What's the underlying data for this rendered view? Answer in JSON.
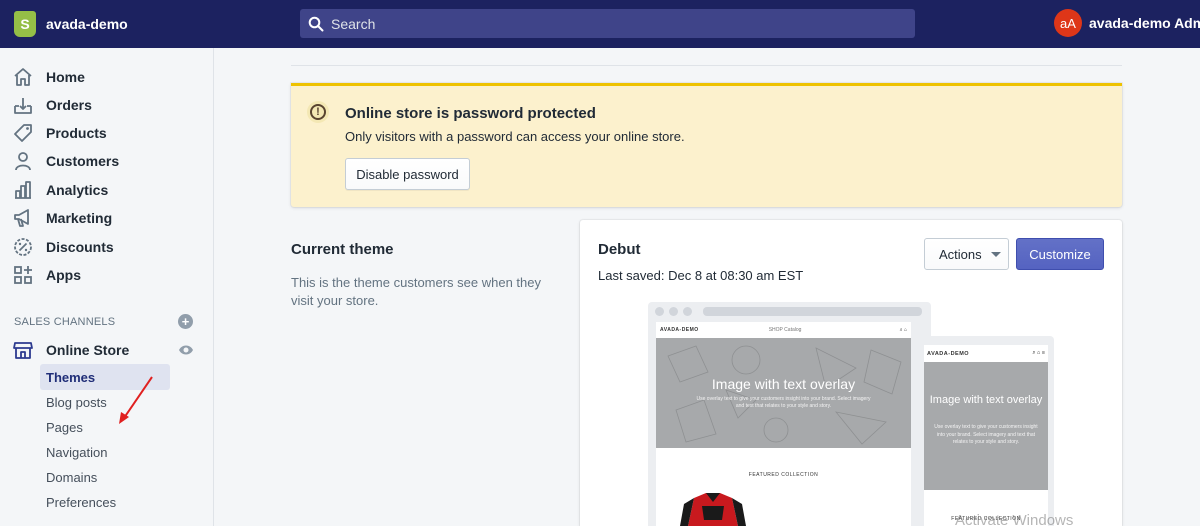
{
  "topbar": {
    "store_name": "avada-demo",
    "logo_letter": "S",
    "search_placeholder": "Search",
    "avatar_initials": "aA",
    "account_name": "avada-demo Admin"
  },
  "sidebar": {
    "items": [
      {
        "label": "Home",
        "icon": "home-icon"
      },
      {
        "label": "Orders",
        "icon": "orders-icon"
      },
      {
        "label": "Products",
        "icon": "tag-icon"
      },
      {
        "label": "Customers",
        "icon": "person-icon"
      },
      {
        "label": "Analytics",
        "icon": "bar-chart-icon"
      },
      {
        "label": "Marketing",
        "icon": "megaphone-icon"
      },
      {
        "label": "Discounts",
        "icon": "discount-icon"
      },
      {
        "label": "Apps",
        "icon": "apps-icon"
      }
    ],
    "sales_channels_title": "SALES CHANNELS",
    "add_symbol": "+",
    "online_store_label": "Online Store",
    "sub_items": [
      "Themes",
      "Blog posts",
      "Pages",
      "Navigation",
      "Domains",
      "Preferences"
    ],
    "active_sub_item": "Themes"
  },
  "banner": {
    "icon_symbol": "!",
    "title": "Online store is password protected",
    "text": "Only visitors with a password can access your online store.",
    "button_label": "Disable password"
  },
  "current_theme": {
    "heading": "Current theme",
    "description": "This is the theme customers see when they visit your store."
  },
  "theme_card": {
    "name": "Debut",
    "last_saved": "Last saved: Dec 8 at 08:30 am EST",
    "actions_label": "Actions",
    "customize_label": "Customize"
  },
  "preview": {
    "desktop": {
      "logo": "AVADA-DEMO",
      "links": "SHOP    Catalog",
      "icons": "⌕ ⌂",
      "hero_title": "Image with text overlay",
      "hero_sub": "Use overlay text to give your customers insight into your brand. Select imagery and text that relates to your style and story.",
      "featured": "FEATURED COLLECTION"
    },
    "mobile": {
      "logo": "AVADA-DEMO",
      "icons": "⌕ ⌂ ≡",
      "hero_title": "Image with text overlay",
      "hero_sub": "Use overlay text to give your customers insight into your brand. Select imagery and text that relates to your style and story.",
      "featured": "FEATURED COLLECTION"
    }
  },
  "watermark": "Activate Windows",
  "colors": {
    "topbar": "#1c2260",
    "accent": "#5c6ac4",
    "warning_bg": "#fcf1cd",
    "warning_border": "#eec200",
    "avatar": "#de3618"
  }
}
